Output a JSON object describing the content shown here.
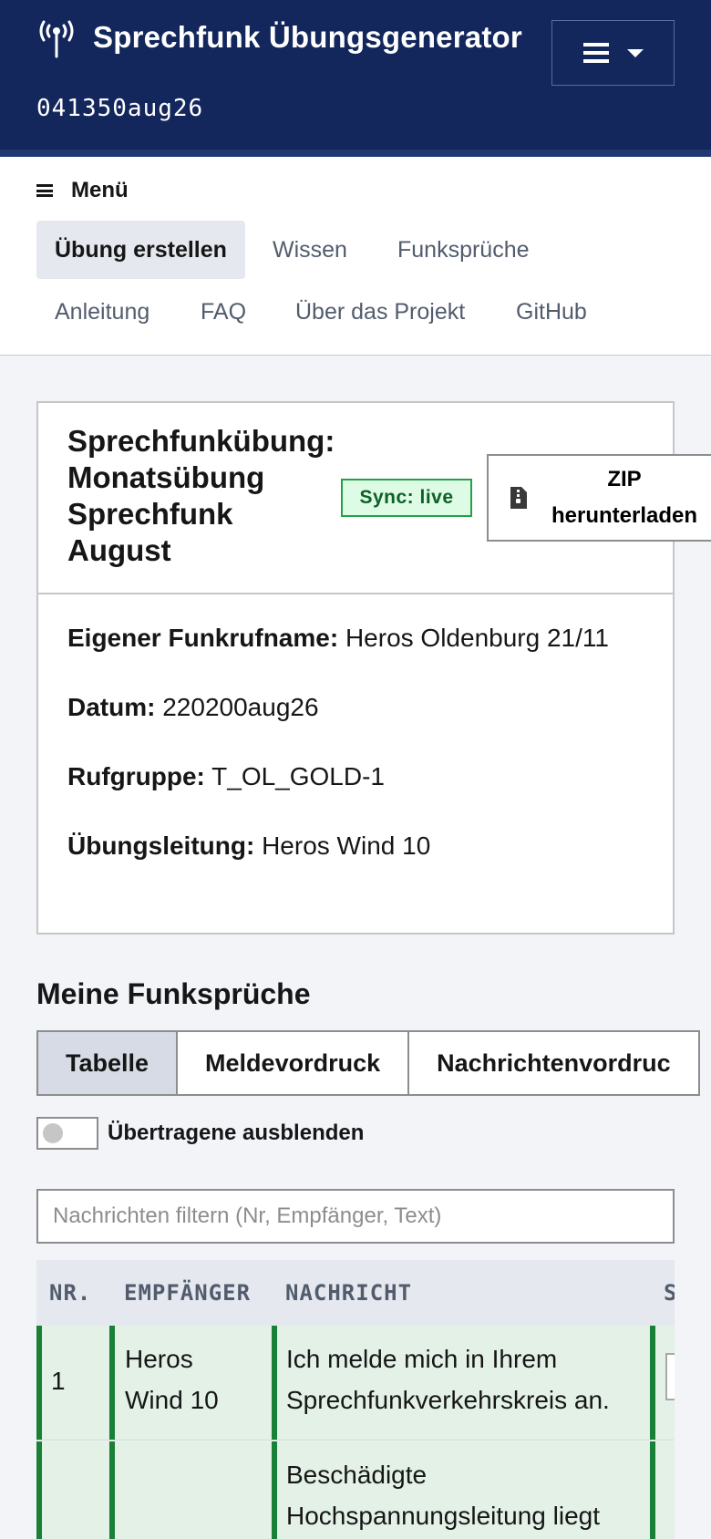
{
  "header": {
    "title": "Sprechfunk Übungsgenerator",
    "timestamp": "041350aug26",
    "icon": "radio-tower-icon",
    "menu_icon": "hamburger-icon"
  },
  "nav": {
    "menu_label": "Menü",
    "items": [
      {
        "label": "Übung erstellen",
        "active": true
      },
      {
        "label": "Wissen"
      },
      {
        "label": "Funksprüche"
      },
      {
        "label": "Anleitung"
      },
      {
        "label": "FAQ"
      },
      {
        "label": "Über das Projekt"
      },
      {
        "label": "GitHub"
      }
    ]
  },
  "exercise": {
    "title": "Sprechfunkübung: Monatsübung Sprechfunk August",
    "sync_status": "Sync: live",
    "zip_button": "ZIP herunterladen",
    "fields": [
      {
        "label": "Eigener Funkrufname:",
        "value": "Heros Oldenburg 21/11"
      },
      {
        "label": "Datum:",
        "value": "220200aug26"
      },
      {
        "label": "Rufgruppe:",
        "value": "T_OL_GOLD-1"
      },
      {
        "label": "Übungsleitung:",
        "value": "Heros Wind 10"
      }
    ]
  },
  "messages": {
    "section_title": "Meine Funksprüche",
    "tabs": [
      {
        "label": "Tabelle",
        "active": true
      },
      {
        "label": "Meldevordruck"
      },
      {
        "label": "Nachrichtenvordruc"
      }
    ],
    "hide_transmitted_label": "Übertragene ausblenden",
    "hide_transmitted": false,
    "filter_placeholder": "Nachrichten filtern (Nr, Empfänger, Text)",
    "columns": [
      "NR.",
      "EMPFÄNGER",
      "NACHRICHT",
      "S"
    ],
    "rows": [
      {
        "nr": "1",
        "recipient_lines": [
          "Heros",
          "Wind 10"
        ],
        "message_lines": [
          "Ich melde mich in Ihrem",
          "Sprechfunkverkehrskreis an."
        ]
      },
      {
        "nr": "",
        "recipient_lines": [],
        "message_lines": [
          "Beschädigte",
          "Hochspannungsleitung liegt"
        ]
      }
    ]
  },
  "colors": {
    "header_bg": "#13275c",
    "success_green": "#198038",
    "row_bg": "#e3f1e7"
  }
}
